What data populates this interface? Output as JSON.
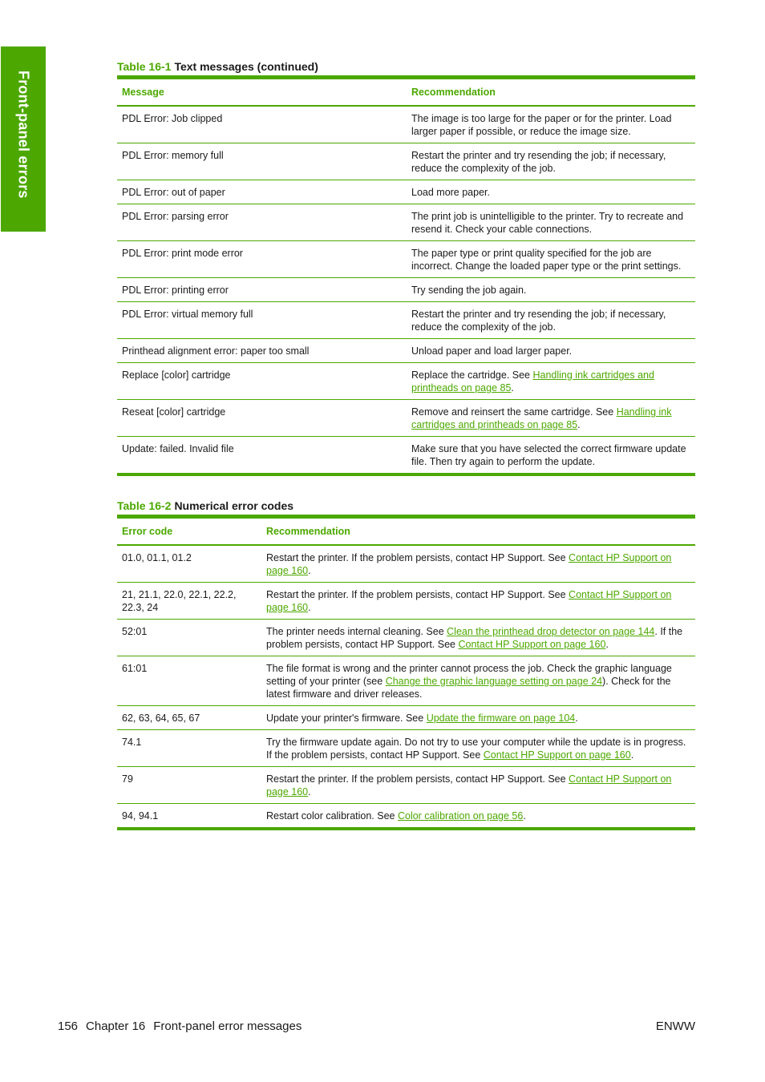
{
  "side_tab": {
    "label": "Front-panel errors"
  },
  "table1": {
    "number": "Table 16-1",
    "title": "Text messages (continued)",
    "headers": [
      "Message",
      "Recommendation"
    ],
    "rows": [
      {
        "message": "PDL Error: Job clipped",
        "rec": [
          {
            "t": "The image is too large for the paper or for the printer. Load larger paper if possible, or reduce the image size."
          }
        ]
      },
      {
        "message": "PDL Error: memory full",
        "rec": [
          {
            "t": "Restart the printer and try resending the job; if necessary, reduce the complexity of the job."
          }
        ]
      },
      {
        "message": "PDL Error: out of paper",
        "rec": [
          {
            "t": "Load more paper."
          }
        ]
      },
      {
        "message": "PDL Error: parsing error",
        "rec": [
          {
            "t": "The print job is unintelligible to the printer. Try to recreate and resend it. Check your cable connections."
          }
        ]
      },
      {
        "message": "PDL Error: print mode error",
        "rec": [
          {
            "t": "The paper type or print quality specified for the job are incorrect. Change the loaded paper type or the print settings."
          }
        ]
      },
      {
        "message": "PDL Error: printing error",
        "rec": [
          {
            "t": "Try sending the job again."
          }
        ]
      },
      {
        "message": "PDL Error: virtual memory full",
        "rec": [
          {
            "t": "Restart the printer and try resending the job; if necessary, reduce the complexity of the job."
          }
        ]
      },
      {
        "message": "Printhead alignment error: paper too small",
        "rec": [
          {
            "t": "Unload paper and load larger paper."
          }
        ]
      },
      {
        "message": "Replace [color] cartridge",
        "rec": [
          {
            "t": "Replace the cartridge. See "
          },
          {
            "link": "Handling ink cartridges and printheads on page 85"
          },
          {
            "t": "."
          }
        ]
      },
      {
        "message": "Reseat [color] cartridge",
        "rec": [
          {
            "t": "Remove and reinsert the same cartridge. See "
          },
          {
            "link": "Handling ink cartridges and printheads on page 85"
          },
          {
            "t": "."
          }
        ]
      },
      {
        "message": "Update: failed. Invalid file",
        "rec": [
          {
            "t": "Make sure that you have selected the correct firmware update file. Then try again to perform the update."
          }
        ]
      }
    ]
  },
  "table2": {
    "number": "Table 16-2",
    "title": "Numerical error codes",
    "headers": [
      "Error code",
      "Recommendation"
    ],
    "rows": [
      {
        "code": "01.0, 01.1, 01.2",
        "rec": [
          {
            "t": "Restart the printer. If the problem persists, contact HP Support. See "
          },
          {
            "link": "Contact HP Support on page 160"
          },
          {
            "t": "."
          }
        ]
      },
      {
        "code": "21, 21.1, 22.0, 22.1, 22.2, 22.3, 24",
        "rec": [
          {
            "t": "Restart the printer. If the problem persists, contact HP Support. See "
          },
          {
            "link": "Contact HP Support on page 160"
          },
          {
            "t": "."
          }
        ]
      },
      {
        "code": "52:01",
        "rec": [
          {
            "t": "The printer needs internal cleaning. See "
          },
          {
            "link": "Clean the printhead drop detector on page 144"
          },
          {
            "t": ". If the problem persists, contact HP Support. See "
          },
          {
            "link": "Contact HP Support on page 160"
          },
          {
            "t": "."
          }
        ]
      },
      {
        "code": "61:01",
        "rec": [
          {
            "t": "The file format is wrong and the printer cannot process the job. Check the graphic language setting of your printer (see "
          },
          {
            "link": "Change the graphic language setting on page 24"
          },
          {
            "t": "). Check for the latest firmware and driver releases."
          }
        ]
      },
      {
        "code": "62, 63, 64, 65, 67",
        "rec": [
          {
            "t": "Update your printer's firmware. See "
          },
          {
            "link": "Update the firmware on page 104"
          },
          {
            "t": "."
          }
        ]
      },
      {
        "code": "74.1",
        "rec": [
          {
            "t": "Try the firmware update again. Do not try to use your computer while the update is in progress. If the problem persists, contact HP Support. See "
          },
          {
            "link": "Contact HP Support on page 160"
          },
          {
            "t": "."
          }
        ]
      },
      {
        "code": "79",
        "rec": [
          {
            "t": "Restart the printer. If the problem persists, contact HP Support. See "
          },
          {
            "link": "Contact HP Support on page 160"
          },
          {
            "t": "."
          }
        ]
      },
      {
        "code": "94, 94.1",
        "rec": [
          {
            "t": "Restart color calibration. See "
          },
          {
            "link": "Color calibration on page 56"
          },
          {
            "t": "."
          }
        ]
      }
    ]
  },
  "footer": {
    "page_number": "156",
    "chapter": "Chapter 16",
    "chapter_title": "Front-panel error messages",
    "locale": "ENWW"
  },
  "colors": {
    "accent": "#4ca800",
    "text": "#1a1a1a"
  }
}
